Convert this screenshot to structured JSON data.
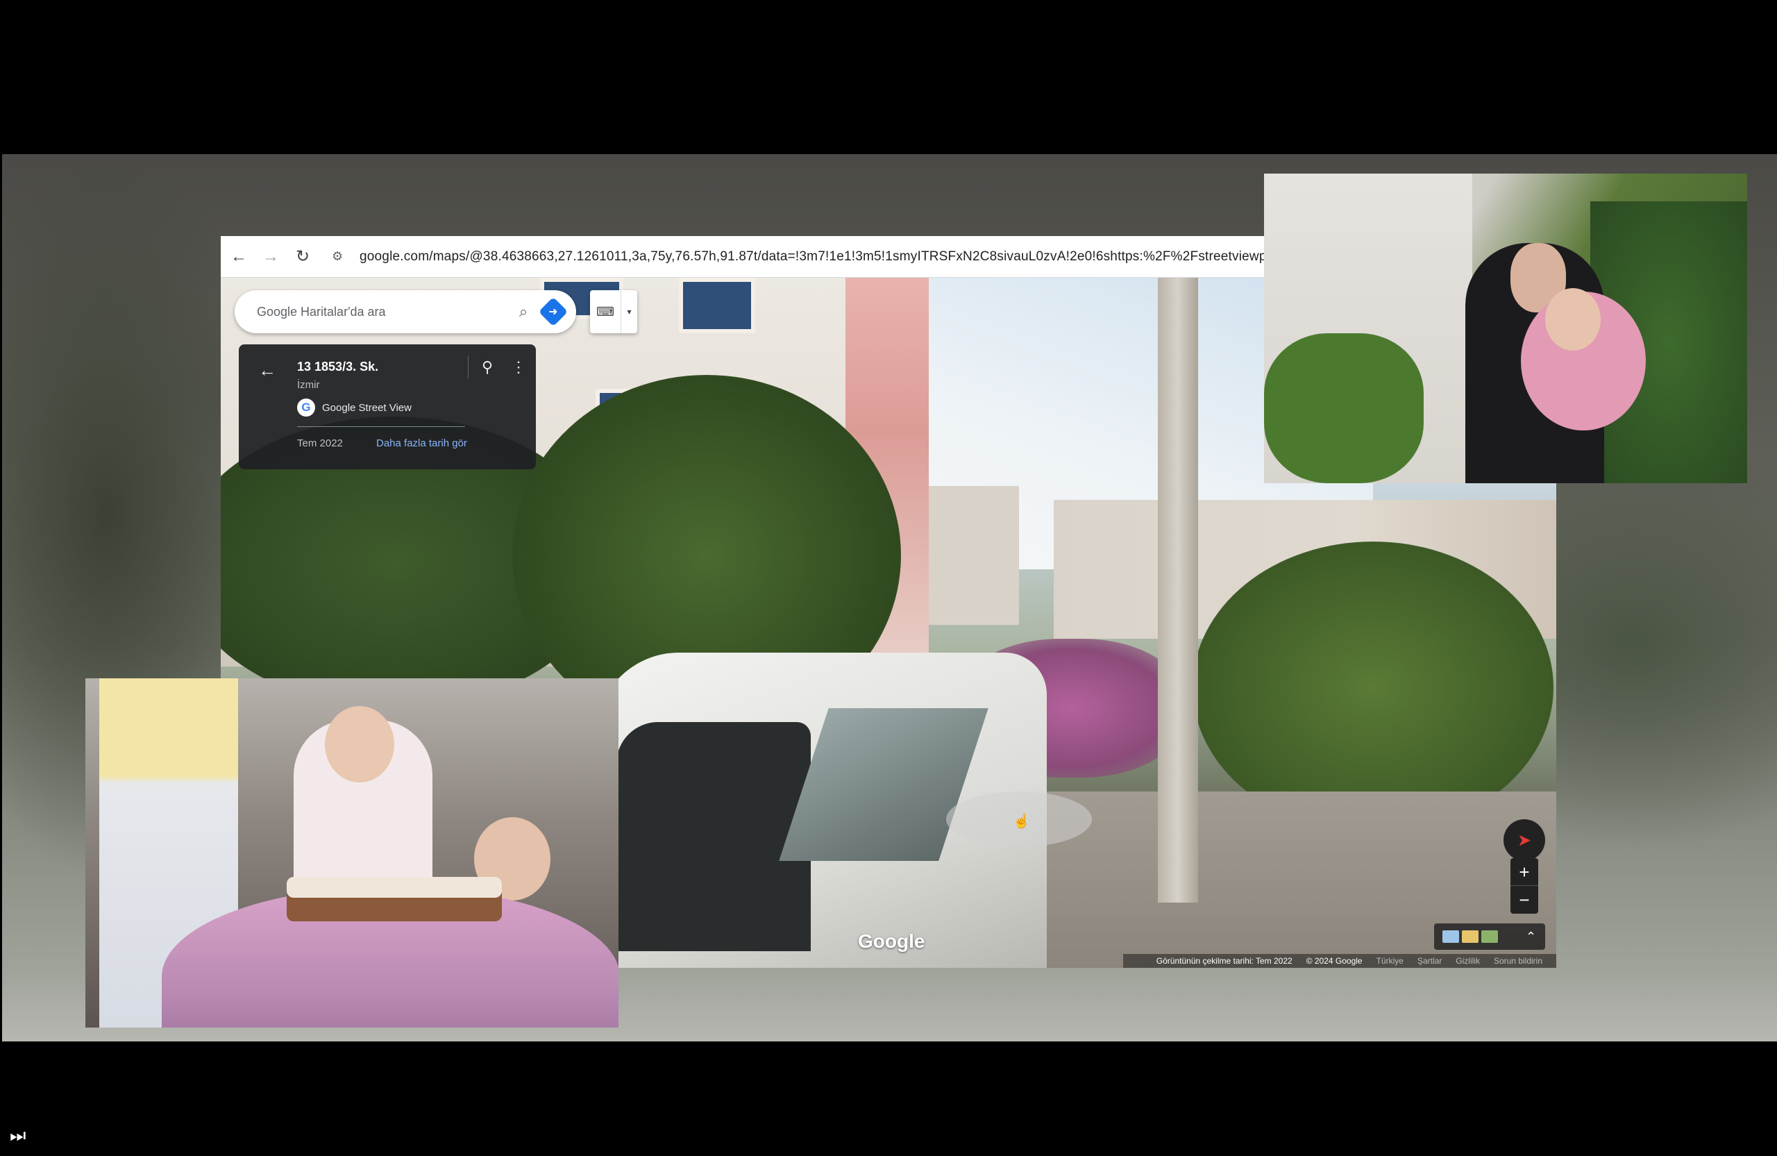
{
  "browser": {
    "url": "google.com/maps/@38.4638663,27.1261011,3a,75y,76.57h,91.87t/data=!3m7!1e1!3m5!1smyITRSFxN2C8sivauL0zvA!2e0!6shttps:%2F%2Fstreetviewp"
  },
  "maps": {
    "search_placeholder": "Google Haritalar'da ara",
    "info_card": {
      "title": "13 1853/3. Sk.",
      "city": "İzmir",
      "provider": "Google Street View",
      "date": "Tem 2022",
      "more_dates_link": "Daha fazla tarih gör"
    },
    "watermark": "Google",
    "footer": {
      "capture_date": "Görüntünün çekilme tarihi: Tem 2022",
      "copyright": "© 2024 Google",
      "country": "Türkiye",
      "terms": "Şartlar",
      "privacy": "Gizlilik",
      "report": "Sorun bildirin"
    },
    "zoom_in": "+",
    "zoom_out": "−"
  },
  "colors": {
    "link": "#8ab4f8",
    "directions": "#1a73e8",
    "compass_needle": "#e53935"
  },
  "icons": [
    "back-arrow-icon",
    "forward-arrow-icon",
    "reload-icon",
    "site-settings-icon",
    "search-icon",
    "directions-icon",
    "keyboard-icon",
    "pin-icon",
    "more-vert-icon",
    "compass-icon",
    "expand-icon",
    "skip-next-icon"
  ]
}
